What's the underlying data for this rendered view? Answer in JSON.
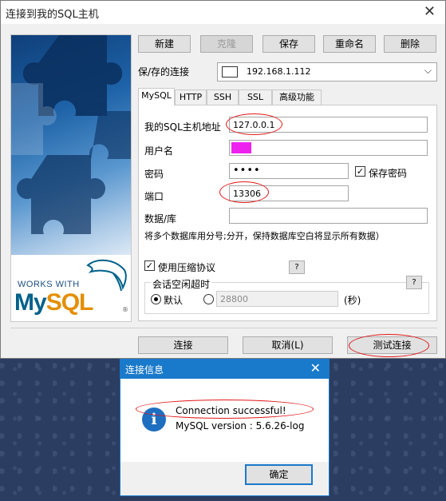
{
  "window": {
    "title": "连接到我的SQL主机"
  },
  "branding": {
    "works_with": "WORKS WITH",
    "mysql_my": "My",
    "mysql_sql": "SQL"
  },
  "toolbar": {
    "new": "新建",
    "clone": "克隆",
    "save": "保存",
    "rename": "重命名",
    "delete": "删除"
  },
  "saved_connection": {
    "label": "保/存的连接",
    "value": "192.168.1.112"
  },
  "tabs": [
    "MySQL",
    "HTTP",
    "SSH",
    "SSL",
    "高级功能"
  ],
  "form": {
    "host_label": "我的SQL主机地址",
    "host_value": "127.0.0.1",
    "user_label": "用户名",
    "password_label": "密码",
    "password_value": "••••",
    "save_password_label": "保存密码",
    "port_label": "端口",
    "port_value": "13306",
    "database_label": "数据/库",
    "database_hint": "将多个数据库用分号;分开，保持数据库空白将显示所有数据）",
    "compression_label": "使用压缩协议",
    "session_timeout_label": "会话空闲超时",
    "default_label": "默认",
    "timeout_value": "28800",
    "seconds_label": "(秒)",
    "help": "?"
  },
  "buttons": {
    "connect": "连接",
    "cancel": "取消(L)",
    "test": "测试连接"
  },
  "dialog": {
    "title": "连接信息",
    "line1": "Connection successful!",
    "line2": "MySQL version : 5.6.26-log",
    "ok": "确定",
    "icon": "i"
  }
}
